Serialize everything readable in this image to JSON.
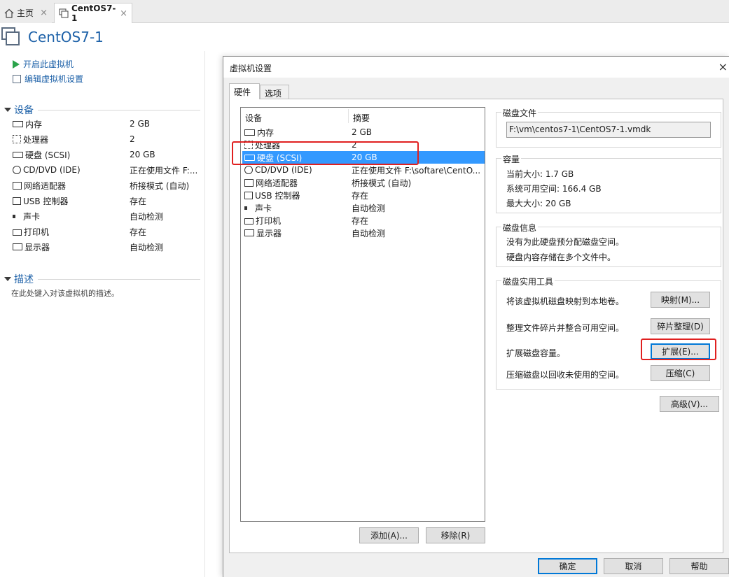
{
  "tabs": {
    "home": "主页",
    "vm": "CentOS7-1",
    "close": "×"
  },
  "vm_title": "CentOS7-1",
  "actions": {
    "power_on": "开启此虚拟机",
    "edit_settings": "编辑虚拟机设置"
  },
  "summary": {
    "devices_heading": "设备",
    "devices": [
      {
        "icon": "memory-icon",
        "name": "内存",
        "value": "2 GB"
      },
      {
        "icon": "processor-icon",
        "name": "处理器",
        "value": "2"
      },
      {
        "icon": "hard-disk-icon",
        "name": "硬盘 (SCSI)",
        "value": "20 GB"
      },
      {
        "icon": "cd-dvd-icon",
        "name": "CD/DVD (IDE)",
        "value": "正在使用文件 F:..."
      },
      {
        "icon": "network-adapter-icon",
        "name": "网络适配器",
        "value": "桥接模式 (自动)"
      },
      {
        "icon": "usb-controller-icon",
        "name": "USB 控制器",
        "value": "存在"
      },
      {
        "icon": "sound-card-icon",
        "name": "声卡",
        "value": "自动检测"
      },
      {
        "icon": "printer-icon",
        "name": "打印机",
        "value": "存在"
      },
      {
        "icon": "display-icon",
        "name": "显示器",
        "value": "自动检测"
      }
    ],
    "description_heading": "描述",
    "description_placeholder": "在此处键入对该虚拟机的描述。"
  },
  "dialog": {
    "title": "虚拟机设置",
    "close": "×",
    "tabs": [
      "硬件",
      "选项"
    ],
    "list_headers": {
      "device": "设备",
      "summary": "摘要"
    },
    "list": [
      {
        "name": "内存",
        "summary": "2 GB"
      },
      {
        "name": "处理器",
        "summary": "2"
      },
      {
        "name": "硬盘 (SCSI)",
        "summary": "20 GB",
        "selected": true
      },
      {
        "name": "CD/DVD (IDE)",
        "summary": "正在使用文件 F:\\softare\\CentO..."
      },
      {
        "name": "网络适配器",
        "summary": "桥接模式 (自动)"
      },
      {
        "name": "USB 控制器",
        "summary": "存在"
      },
      {
        "name": "声卡",
        "summary": "自动检测"
      },
      {
        "name": "打印机",
        "summary": "存在"
      },
      {
        "name": "显示器",
        "summary": "自动检测"
      }
    ],
    "add_button": "添加(A)...",
    "remove_button": "移除(R)",
    "disk_file": {
      "title": "磁盘文件",
      "path": "F:\\vm\\centos7-1\\CentOS7-1.vmdk"
    },
    "capacity": {
      "title": "容量",
      "current": "当前大小: 1.7 GB",
      "available": "系统可用空间: 166.4 GB",
      "max": "最大大小: 20 GB"
    },
    "disk_info": {
      "title": "磁盘信息",
      "line1": "没有为此硬盘预分配磁盘空间。",
      "line2": "硬盘内容存储在多个文件中。"
    },
    "utilities": {
      "title": "磁盘实用工具",
      "map_text": "将该虚拟机磁盘映射到本地卷。",
      "map_button": "映射(M)...",
      "defrag_text": "整理文件碎片并整合可用空间。",
      "defrag_button": "碎片整理(D)",
      "expand_text": "扩展磁盘容量。",
      "expand_button": "扩展(E)...",
      "compact_text": "压缩磁盘以回收未使用的空间。",
      "compact_button": "压缩(C)"
    },
    "advanced_button": "高级(V)...",
    "ok_button": "确定",
    "cancel_button": "取消",
    "help_button": "帮助"
  },
  "colors": {
    "accent": "#1d61a8",
    "selection": "#3399ff",
    "highlight": "#e02020",
    "play": "#2aa34a"
  }
}
